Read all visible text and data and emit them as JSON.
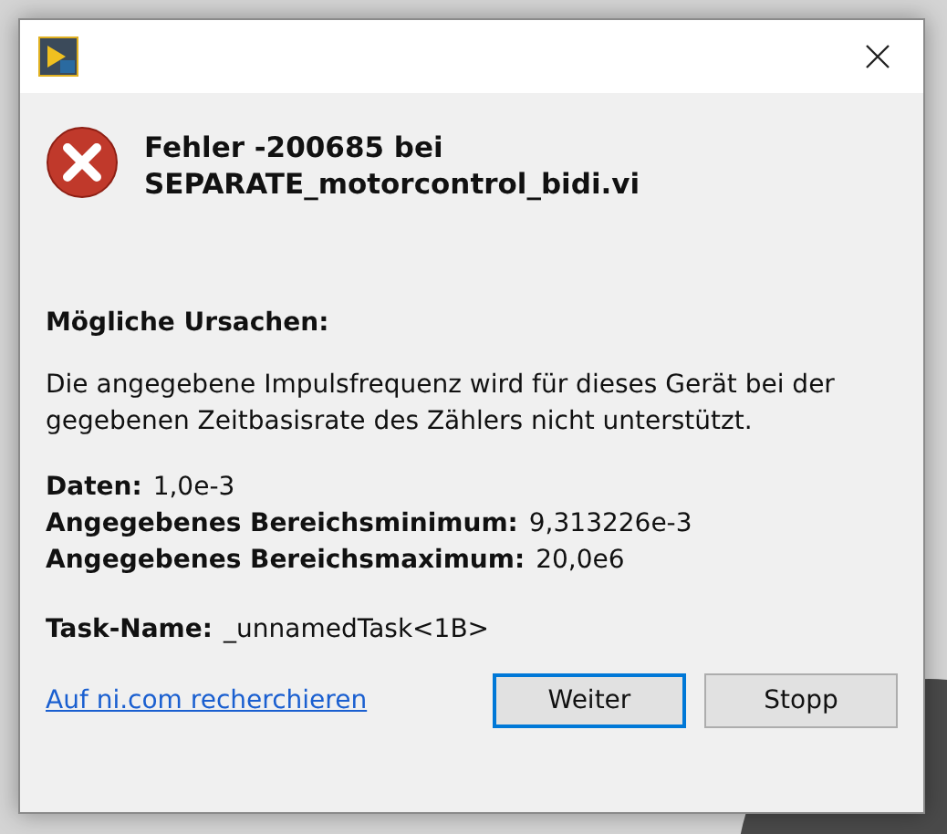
{
  "error": {
    "heading": "Fehler -200685 bei",
    "source": "SEPARATE_motorcontrol_bidi.vi"
  },
  "causes_label": "Mögliche Ursachen:",
  "message": "Die angegebene Impulsfrequenz wird für dieses Gerät bei der gegebenen Zeitbasisrate des Zählers nicht unterstützt.",
  "details": [
    {
      "label": "Daten:",
      "value": "1,0e-3"
    },
    {
      "label": "Angegebenes Bereichsminimum:",
      "value": "9,313226e-3"
    },
    {
      "label": "Angegebenes Bereichsmaximum:",
      "value": "20,0e6"
    }
  ],
  "task": {
    "label": "Task-Name:",
    "value": "_unnamedTask<1B>"
  },
  "link": "Auf ni.com recherchieren",
  "buttons": [
    {
      "label": "Weiter",
      "selected": true
    },
    {
      "label": "Stopp",
      "selected": false
    }
  ]
}
